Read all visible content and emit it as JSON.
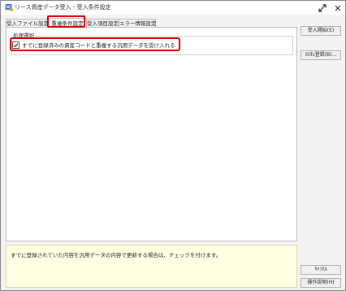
{
  "window": {
    "title": "リース資産データ受入 - 受入条件設定"
  },
  "tabs": [
    {
      "label": "受入ファイル設定"
    },
    {
      "label": "重複条件設定"
    },
    {
      "label": "受入項目設定"
    },
    {
      "label": "エラー情報設定"
    }
  ],
  "panel": {
    "group_label": "処理選択",
    "checkbox": {
      "label": "すでに登録済みの資産コードと重複する汎用データを受け入れる",
      "checked": true
    }
  },
  "side_buttons": {
    "start": "受入開始(E)",
    "register": "ｶｽﾀﾑ登録(B)...",
    "cancel": "ｷｬﾝｾﾙ",
    "help": "操作説明(H)"
  },
  "hint": {
    "text": "すでに登録されていた内容を汎用データの内容で更新する場合は、チェックを付けます。"
  },
  "colors": {
    "highlight": "#d40000",
    "hint_background": "#ffffe1"
  }
}
